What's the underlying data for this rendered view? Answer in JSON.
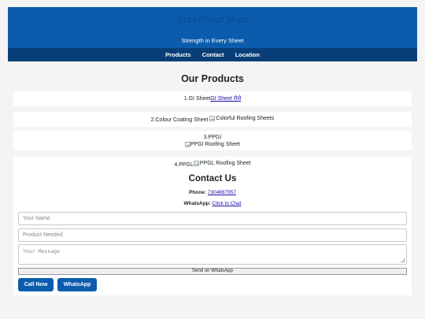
{
  "header": {
    "brand": "SteelRoof Mart",
    "tagline": "Strength in Every Sheet"
  },
  "nav": {
    "items": [
      "Products",
      "Contact",
      "Location"
    ]
  },
  "products": {
    "title": "Our Products",
    "items": [
      {
        "label": "1.GI Sheet",
        "link_text": "GI Sheet रोले"
      },
      {
        "label": "2.Colour Coating Sheet",
        "img_alt": "Colorful Roofing Sheets"
      },
      {
        "label": "3.PPGI",
        "img_alt": "PPGI Roofing Sheet"
      },
      {
        "label": "4.PPGL",
        "img_alt": "PPGL Roofing Sheet"
      }
    ]
  },
  "contact": {
    "title": "Contact Us",
    "phone_label": "Phone:",
    "phone_value": "7304887957",
    "whatsapp_label": "WhatsApp:",
    "whatsapp_link": "Click to Chat"
  },
  "form": {
    "name_placeholder": "Your Name",
    "product_placeholder": "Product Needed",
    "message_placeholder": "Your Message",
    "send_label": "Send on WhatsApp"
  },
  "actions": {
    "call_label": "Call Now",
    "whatsapp_label": "WhatsApp"
  },
  "colors": {
    "primary": "#0b5cad",
    "nav": "#083f78",
    "link": "#1a0dab",
    "background": "#f4f4f4"
  }
}
